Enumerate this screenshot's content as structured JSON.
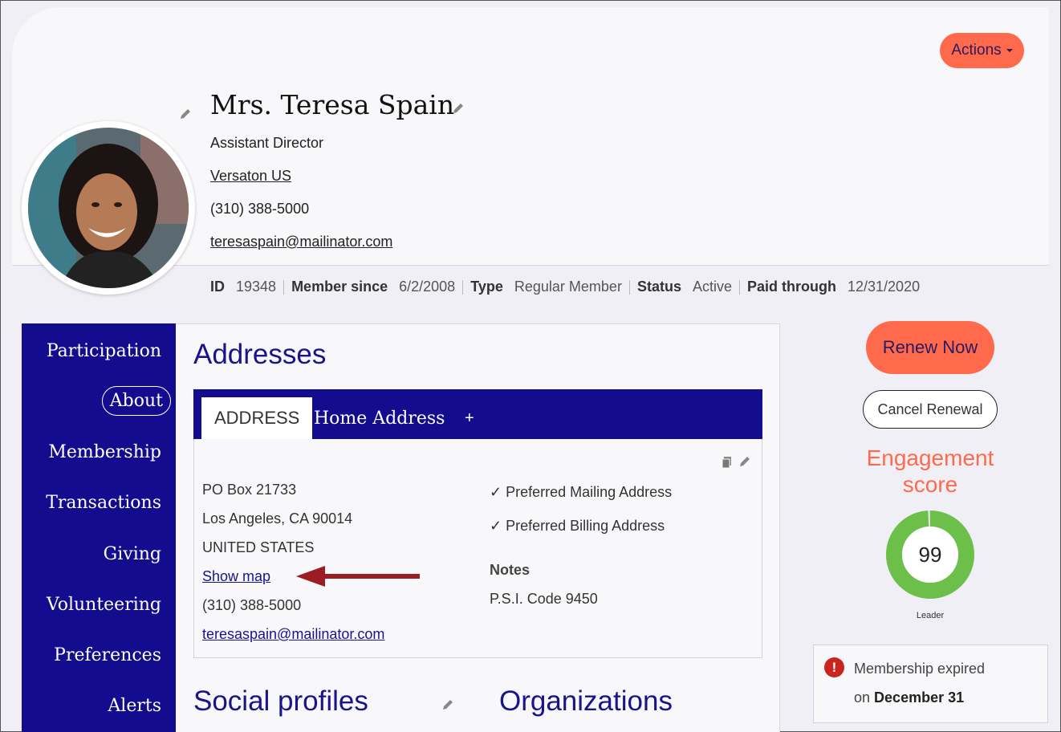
{
  "header": {
    "actions_label": "Actions",
    "name": "Mrs. Teresa Spain",
    "title": "Assistant Director",
    "company": "Versaton US",
    "phone": "(310) 388-5000",
    "email": "teresaspain@mailinator.com"
  },
  "meta": {
    "id_label": "ID",
    "id_value": "19348",
    "since_label": "Member since",
    "since_value": "6/2/2008",
    "type_label": "Type",
    "type_value": "Regular Member",
    "status_label": "Status",
    "status_value": "Active",
    "paid_label": "Paid through",
    "paid_value": "12/31/2020"
  },
  "sidebar": {
    "items": [
      {
        "label": "Participation"
      },
      {
        "label": "About"
      },
      {
        "label": "Membership"
      },
      {
        "label": "Transactions"
      },
      {
        "label": "Giving"
      },
      {
        "label": "Volunteering"
      },
      {
        "label": "Preferences"
      },
      {
        "label": "Alerts"
      }
    ],
    "active": "About"
  },
  "addresses": {
    "heading": "Addresses",
    "tabs": [
      "ADDRESS",
      "Home Address",
      "+"
    ],
    "line1": "PO Box 21733",
    "line2": "Los Angeles, CA 90014",
    "country": "UNITED STATES",
    "show_map": "Show map",
    "phone": "(310) 388-5000",
    "email": "teresaspain@mailinator.com",
    "pref_mailing": "✓ Preferred Mailing Address",
    "pref_billing": "✓ Preferred Billing Address",
    "notes_label": "Notes",
    "notes_value": "P.S.I. Code 9450"
  },
  "sections": {
    "social": "Social profiles",
    "orgs": "Organizations"
  },
  "right": {
    "renew_label": "Renew Now",
    "cancel_label": "Cancel Renewal",
    "engagement_line1": "Engagement",
    "engagement_line2": "score",
    "score": "99",
    "score_fraction": 0.99,
    "score_label": "Leader",
    "expired_line1": "Membership expired",
    "expired_on": "on",
    "expired_date": "December 31"
  },
  "colors": {
    "brand_navy": "#130c8e",
    "accent_orange": "#ff6a4d",
    "gauge_green": "#6cc04a",
    "alert_red": "#c9241d",
    "arrow_red": "#9b1c22"
  }
}
